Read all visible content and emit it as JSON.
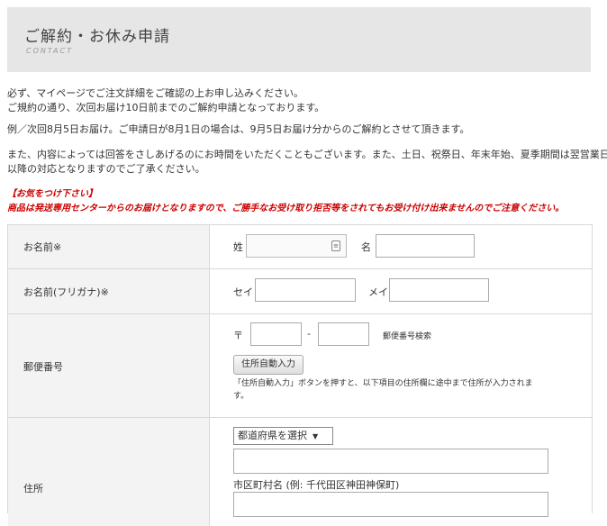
{
  "header": {
    "title": "ご解約・お休み申請",
    "subtitle": "CONTACT"
  },
  "intro": {
    "p1_line1": "必ず、マイページでご注文詳細をご確認の上お申し込みください。",
    "p1_line2": "ご規約の通り、次回お届け10日前までのご解約申請となっております。",
    "p2": "例／次回8月5日お届け。ご申請日が8月1日の場合は、9月5日お届け分からのご解約とさせて頂きます。",
    "p3_line1": "また、内容によっては回答をさしあげるのにお時間をいただくこともございます。また、土日、祝祭日、年末年始、夏季期間は翌営業日",
    "p3_line2": "以降の対応となりますのでご了承ください。"
  },
  "notice": {
    "heading": "【お気をつけ下さい】",
    "text": "商品は発送専用センターからのお届けとなりますので、ご勝手なお受け取り拒否等をされてもお受け付け出来ませんのでご注意ください。"
  },
  "form": {
    "name": {
      "label": "お名前※",
      "sei_label": "姓",
      "mei_label": "名",
      "sei_value": "",
      "mei_value": ""
    },
    "kana": {
      "label": "お名前(フリガナ)※",
      "sei_label": "セイ",
      "mei_label": "メイ",
      "sei_value": "",
      "mei_value": ""
    },
    "postal": {
      "label": "郵便番号",
      "mark": "〒",
      "dash": "-",
      "search_link": "郵便番号検索",
      "auto_button": "住所自動入力",
      "hint_line1": "「住所自動入力」ボタンを押すと、以下項目の住所欄に途中まで住所が入力されま",
      "hint_line2": "す。"
    },
    "address": {
      "label": "住所",
      "prefecture_select": "都道府県を選択",
      "city_label": "市区町村名 (例: 千代田区神田神保町)"
    }
  },
  "colors": {
    "header_bg": "#e6e6e6",
    "notice_red": "#cc0000",
    "label_bg": "#f3f3f3",
    "border": "#d8d8d8"
  }
}
